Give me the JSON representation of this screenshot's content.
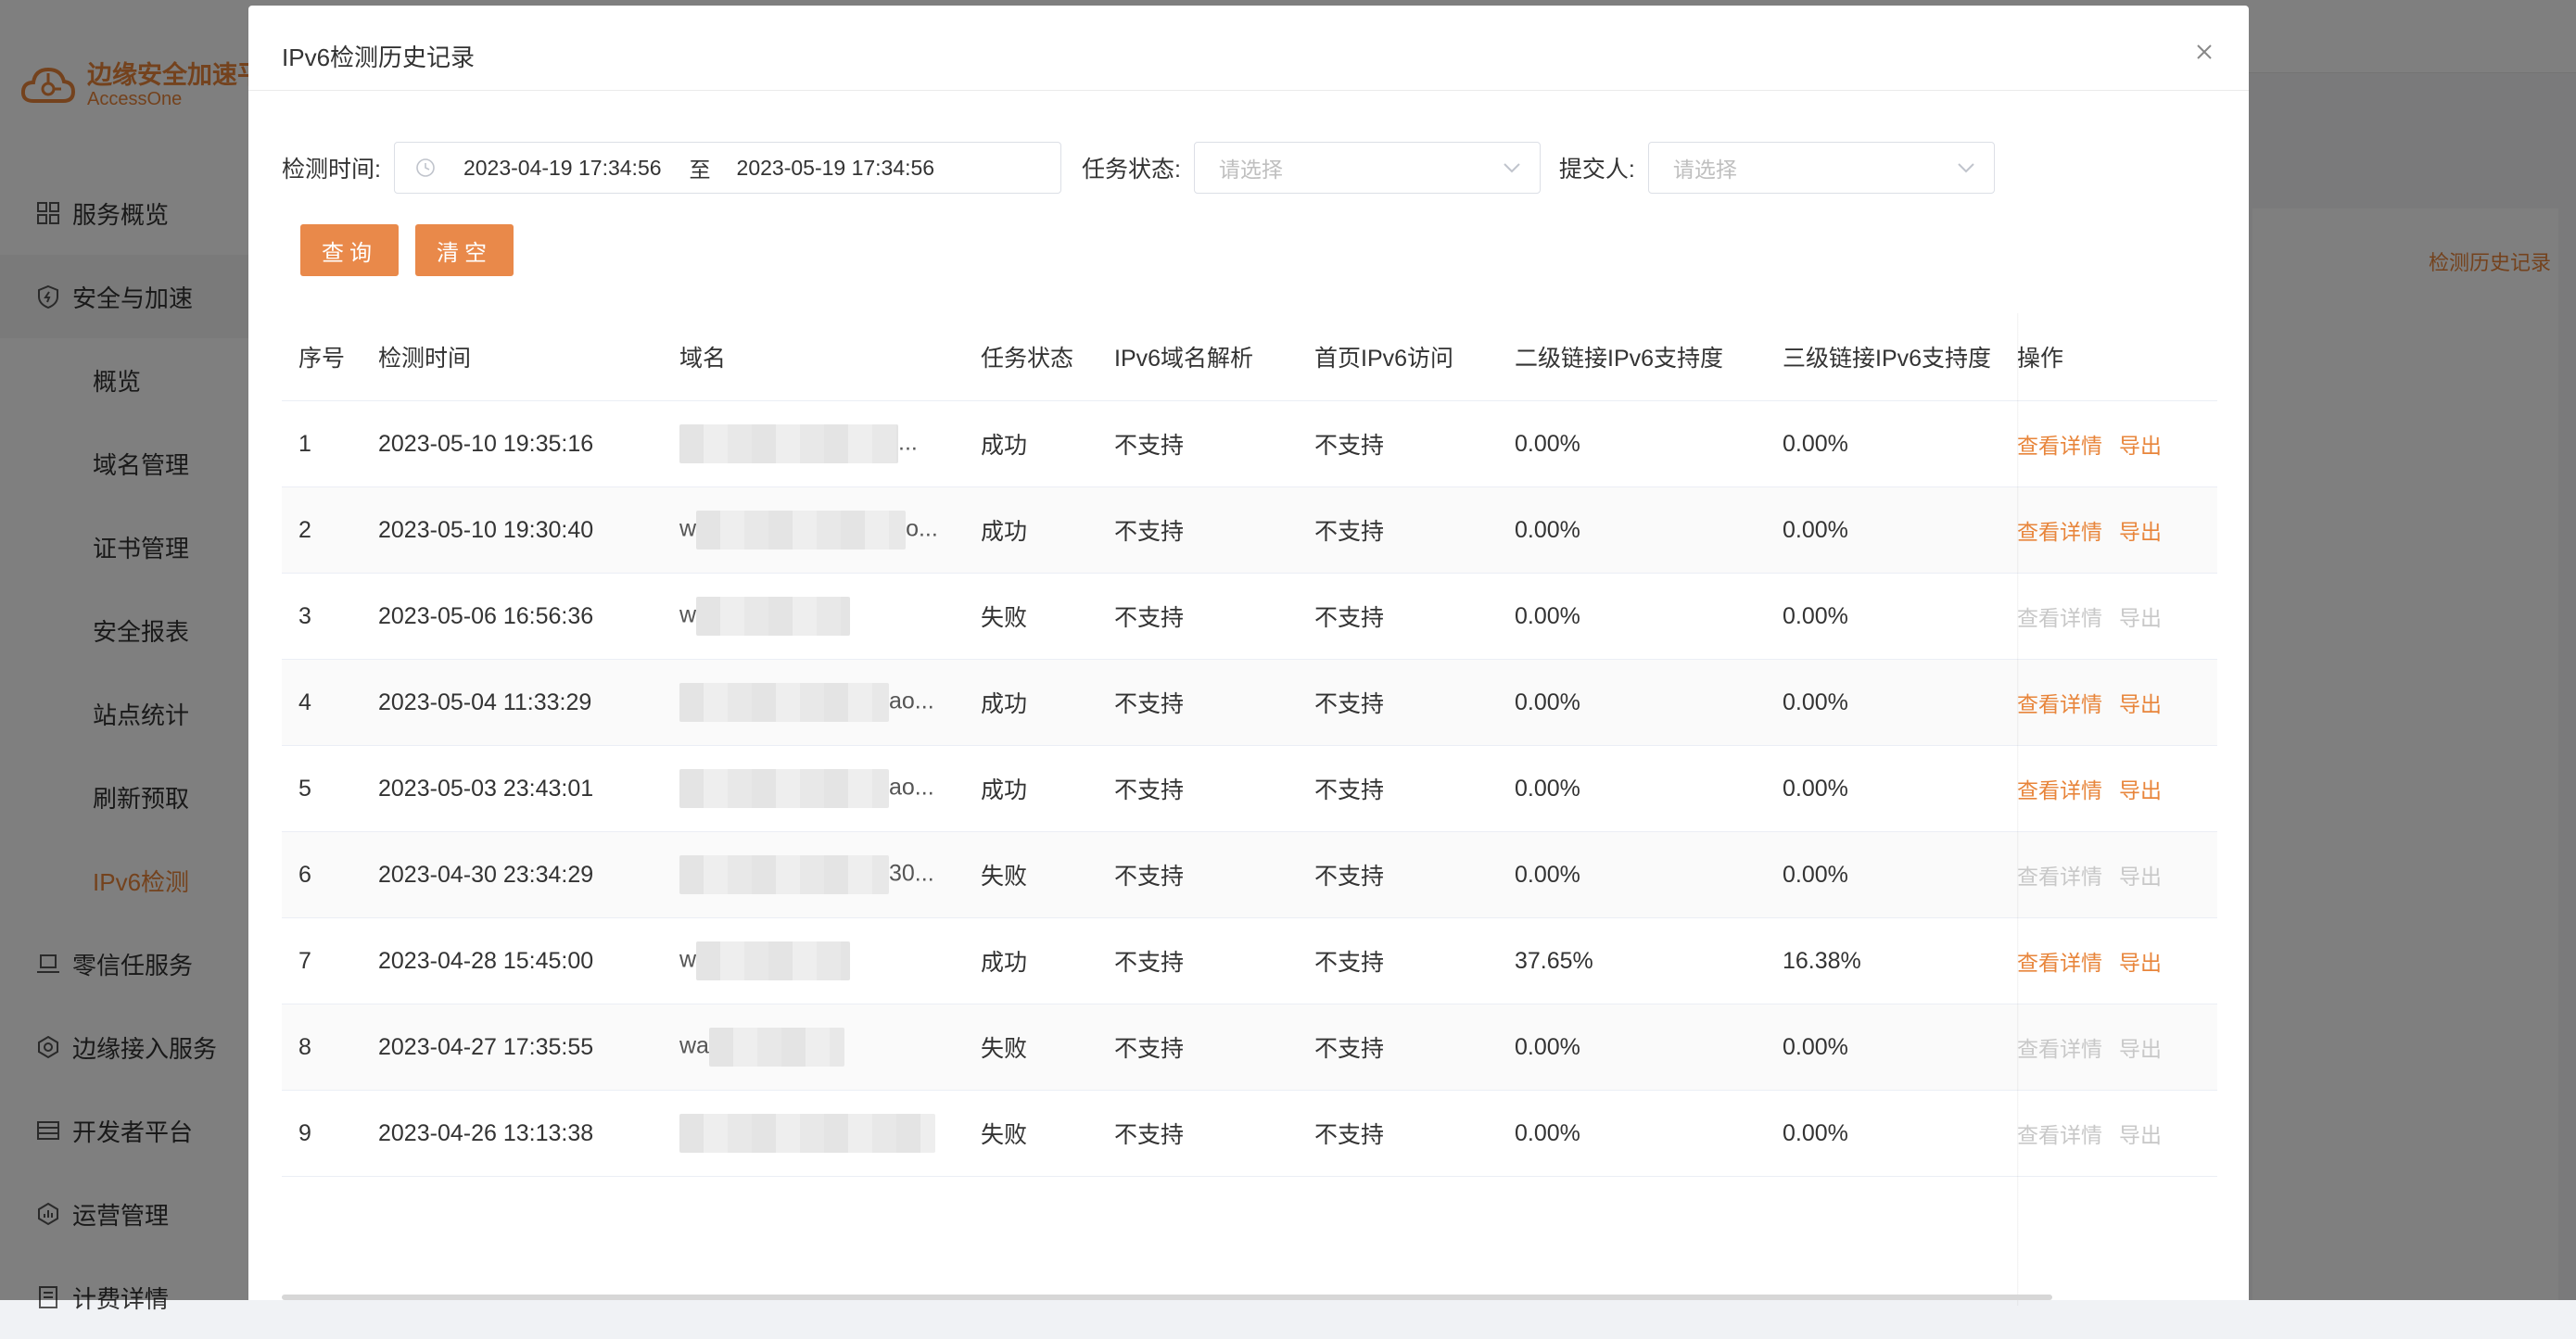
{
  "app": {
    "logo_title": "边缘安全加速平",
    "logo_subtitle": "AccessOne",
    "history_link": "检测历史记录",
    "nav": [
      {
        "label": "服务概览",
        "type": "top",
        "icon": "grid-icon"
      },
      {
        "label": "安全与加速",
        "type": "top",
        "icon": "shield-icon"
      },
      {
        "label": "概览",
        "type": "sub"
      },
      {
        "label": "域名管理",
        "type": "sub"
      },
      {
        "label": "证书管理",
        "type": "sub"
      },
      {
        "label": "安全报表",
        "type": "sub"
      },
      {
        "label": "站点统计",
        "type": "sub"
      },
      {
        "label": "刷新预取",
        "type": "sub"
      },
      {
        "label": "IPv6检测",
        "type": "sub",
        "active": true
      },
      {
        "label": "零信任服务",
        "type": "top",
        "icon": "laptop-icon"
      },
      {
        "label": "边缘接入服务",
        "type": "top",
        "icon": "network-icon"
      },
      {
        "label": "开发者平台",
        "type": "top",
        "icon": "server-icon"
      },
      {
        "label": "运营管理",
        "type": "top",
        "icon": "chart-icon"
      },
      {
        "label": "计费详情",
        "type": "top",
        "icon": "bill-icon"
      }
    ]
  },
  "modal": {
    "title": "IPv6检测历史记录",
    "filters": {
      "time_label": "检测时间:",
      "start": "2023-04-19 17:34:56",
      "range_sep": "至",
      "end": "2023-05-19 17:34:56",
      "status_label": "任务状态:",
      "status_placeholder": "请选择",
      "submitter_label": "提交人:",
      "submitter_placeholder": "请选择"
    },
    "buttons": {
      "query": "查询",
      "clear": "清空"
    },
    "columns": [
      "序号",
      "检测时间",
      "域名",
      "任务状态",
      "IPv6域名解析",
      "首页IPv6访问",
      "二级链接IPv6支持度",
      "三级链接IPv6支持度",
      "操作"
    ],
    "action_labels": {
      "detail": "查看详情",
      "export": "导出"
    },
    "rows": [
      {
        "idx": "1",
        "time": "2023-05-10 19:35:16",
        "domain_head": "",
        "domain_tail": "...",
        "status": "成功",
        "dns": "不支持",
        "home": "不支持",
        "l2": "0.00%",
        "l3": "0.00%",
        "enabled": true
      },
      {
        "idx": "2",
        "time": "2023-05-10 19:30:40",
        "domain_head": "w",
        "domain_tail": "o...",
        "status": "成功",
        "dns": "不支持",
        "home": "不支持",
        "l2": "0.00%",
        "l3": "0.00%",
        "enabled": true
      },
      {
        "idx": "3",
        "time": "2023-05-06 16:56:36",
        "domain_head": "w",
        "domain_tail": "",
        "status": "失败",
        "dns": "不支持",
        "home": "不支持",
        "l2": "0.00%",
        "l3": "0.00%",
        "enabled": false
      },
      {
        "idx": "4",
        "time": "2023-05-04 11:33:29",
        "domain_head": "",
        "domain_tail": "ao...",
        "status": "成功",
        "dns": "不支持",
        "home": "不支持",
        "l2": "0.00%",
        "l3": "0.00%",
        "enabled": true
      },
      {
        "idx": "5",
        "time": "2023-05-03 23:43:01",
        "domain_head": "",
        "domain_tail": "ao...",
        "status": "成功",
        "dns": "不支持",
        "home": "不支持",
        "l2": "0.00%",
        "l3": "0.00%",
        "enabled": true
      },
      {
        "idx": "6",
        "time": "2023-04-30 23:34:29",
        "domain_head": "",
        "domain_tail": "30...",
        "status": "失败",
        "dns": "不支持",
        "home": "不支持",
        "l2": "0.00%",
        "l3": "0.00%",
        "enabled": false
      },
      {
        "idx": "7",
        "time": "2023-04-28 15:45:00",
        "domain_head": "w",
        "domain_tail": "",
        "status": "成功",
        "dns": "不支持",
        "home": "不支持",
        "l2": "37.65%",
        "l3": "16.38%",
        "enabled": true
      },
      {
        "idx": "8",
        "time": "2023-04-27 17:35:55",
        "domain_head": "wa",
        "domain_tail": "",
        "status": "失败",
        "dns": "不支持",
        "home": "不支持",
        "l2": "0.00%",
        "l3": "0.00%",
        "enabled": false
      },
      {
        "idx": "9",
        "time": "2023-04-26 13:13:38",
        "domain_head": "",
        "domain_tail": "",
        "status": "失败",
        "dns": "不支持",
        "home": "不支持",
        "l2": "0.00%",
        "l3": "0.00%",
        "enabled": false
      }
    ]
  }
}
